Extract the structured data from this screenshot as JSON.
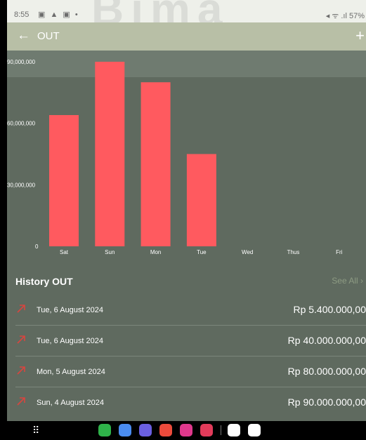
{
  "status_bar": {
    "time": "8:55",
    "left_icons": "▣ ▲ ▣ •",
    "right_text": "◂ ᯤ .ıl 57%"
  },
  "watermark": "Bima",
  "app_bar": {
    "title": "OUT",
    "back_icon": "arrow-left-icon",
    "add_icon": "plus-icon"
  },
  "colors": {
    "background": "#5f6a5f",
    "bar": "#ff5a5f",
    "app_bar": "#b8bfa6",
    "see_all": "#8d9b83"
  },
  "chart_data": {
    "type": "bar",
    "categories": [
      "Sat",
      "Sun",
      "Mon",
      "Tue",
      "Wed",
      "Thus",
      "Fri"
    ],
    "values": [
      64000000,
      90000000,
      80000000,
      45000000,
      0,
      0,
      0
    ],
    "yticks": [
      "0",
      "30,000,000",
      "60,000,000",
      "90,000,000"
    ],
    "ylim": [
      0,
      90000000
    ],
    "grid": false
  },
  "history": {
    "title": "History OUT",
    "see_all": "See All",
    "items": [
      {
        "date": "Tue, 6 August 2024",
        "amount": "Rp 5.400.000,00"
      },
      {
        "date": "Tue, 6 August 2024",
        "amount": "Rp 40.000.000,00"
      },
      {
        "date": "Mon, 5 August 2024",
        "amount": "Rp 80.000.000,00"
      },
      {
        "date": "Sun, 4 August 2024",
        "amount": "Rp 90.000.000,00"
      }
    ]
  },
  "nav_bar": {
    "apps_icon": "app-grid-icon",
    "dock": [
      {
        "name": "phone-app-icon",
        "color": "#2fb34a"
      },
      {
        "name": "messages-app-icon",
        "color": "#4a8cf0"
      },
      {
        "name": "internet-app-icon",
        "color": "#6a5fe0"
      },
      {
        "name": "notes-app-icon",
        "color": "#ec4b3c"
      },
      {
        "name": "flower-app-icon",
        "color": "#e0388c"
      },
      {
        "name": "camera-app-icon",
        "color": "#e23b5a"
      },
      {
        "name": "play-store-icon",
        "color": "#ffffff"
      },
      {
        "name": "gmail-icon",
        "color": "#ffffff"
      }
    ]
  }
}
